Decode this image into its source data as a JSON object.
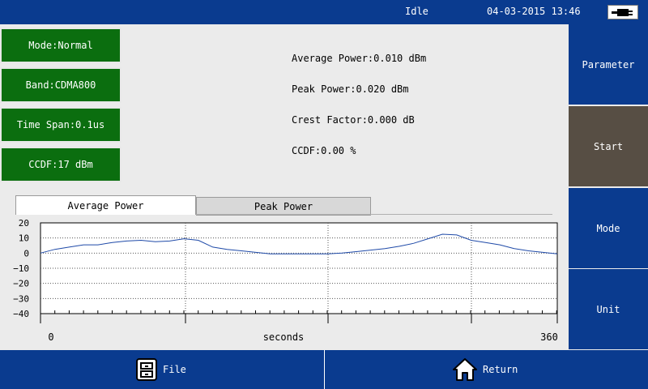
{
  "status": {
    "state": "Idle",
    "datetime": "04-03-2015 13:46",
    "battery_icon": "plug-battery-icon"
  },
  "settings": {
    "mode": "Mode:Normal",
    "band": "Band:CDMA800",
    "time_span": "Time Span:0.1us",
    "ccdf": "CCDF:17 dBm"
  },
  "readouts": {
    "average_power": "Average Power:0.010 dBm",
    "peak_power": "Peak Power:0.020 dBm",
    "crest_factor": "Crest Factor:0.000 dB",
    "ccdf": "CCDF:0.00 %"
  },
  "menu": {
    "parameter": "Parameter",
    "start": "Start",
    "mode": "Mode",
    "unit": "Unit"
  },
  "tabs": {
    "average_power": "Average Power",
    "peak_power": "Peak Power"
  },
  "bottom": {
    "file": "File",
    "return": "Return"
  },
  "colors": {
    "header": "#0a3b8f",
    "settings_box": "#0b6e0f",
    "active_menu": "#574e44",
    "trace": "#1f4aa8"
  },
  "chart_data": {
    "type": "line",
    "xlabel": "seconds",
    "xlim": [
      0,
      360
    ],
    "x_tick_labels": [
      "0",
      "360"
    ],
    "ylim": [
      -40,
      20
    ],
    "y_ticks": [
      20,
      10,
      0,
      -10,
      -20,
      -30,
      -40
    ],
    "y_tick_labels": [
      "20",
      "10",
      "0",
      "−10",
      "−20",
      "−30",
      "−40"
    ],
    "grid": true,
    "series": [
      {
        "x": [
          0,
          10,
          20,
          30,
          40,
          50,
          60,
          70,
          80,
          90,
          100,
          110,
          120,
          130,
          140,
          150,
          160,
          170,
          180,
          190,
          200,
          210,
          220,
          230,
          240,
          250,
          260,
          270,
          280,
          290,
          300,
          310,
          320,
          330,
          340,
          350,
          360
        ],
        "values": [
          0,
          2.5,
          4,
          5.5,
          5.5,
          7,
          8,
          8.5,
          7.5,
          8,
          9.5,
          8.5,
          4,
          2.5,
          1.5,
          0.5,
          -0.5,
          -0.5,
          -0.5,
          -0.5,
          -0.5,
          0,
          1,
          2,
          3,
          4.5,
          6.5,
          9.5,
          12.5,
          12,
          8.5,
          7,
          5.5,
          3,
          1.5,
          0.5,
          -0.5
        ]
      }
    ]
  }
}
